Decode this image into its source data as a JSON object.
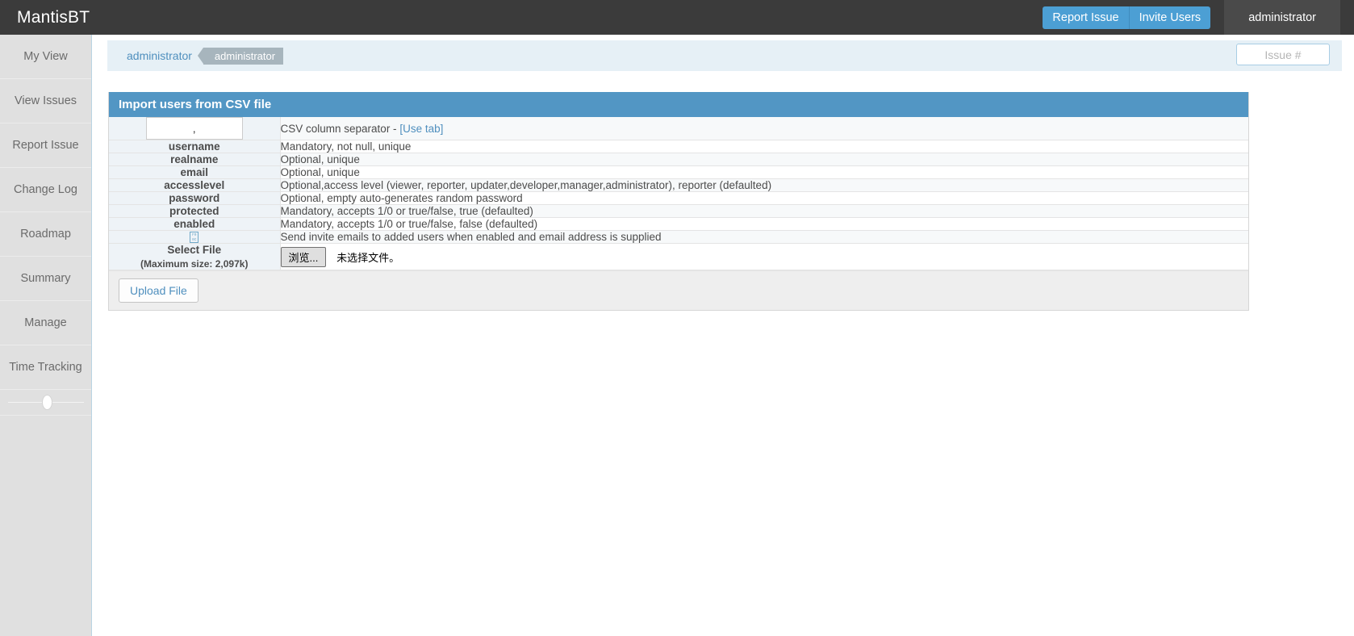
{
  "navbar": {
    "brand": "MantisBT",
    "report_issue_label": "Report Issue",
    "invite_users_label": "Invite Users",
    "user_label": "administrator",
    "accent_color": "#4c9fd4",
    "bg_color": "#3b3b3b"
  },
  "sidebar": {
    "items": [
      {
        "label": "My View"
      },
      {
        "label": "View Issues"
      },
      {
        "label": "Report Issue"
      },
      {
        "label": "Change Log"
      },
      {
        "label": "Roadmap"
      },
      {
        "label": "Summary"
      },
      {
        "label": "Manage"
      },
      {
        "label": "Time Tracking"
      }
    ]
  },
  "breadcrumb": {
    "link": "administrator",
    "tag": "administrator",
    "issue_search_placeholder": "Issue #",
    "issue_search_value": ""
  },
  "panel": {
    "title": "Import users from CSV file",
    "separator_value": ",",
    "separator_desc_prefix": "CSV column separator - ",
    "use_tab_label": "[Use tab]",
    "rows": [
      {
        "label": "username",
        "desc": "Mandatory, not null, unique"
      },
      {
        "label": "realname",
        "desc": "Optional, unique"
      },
      {
        "label": "email",
        "desc": "Optional, unique"
      },
      {
        "label": "accesslevel",
        "desc": "Optional,access level (viewer, reporter, updater,developer,manager,administrator), reporter (defaulted)"
      },
      {
        "label": "password",
        "desc": "Optional, empty auto-generates random password"
      },
      {
        "label": "protected",
        "desc": "Mandatory, accepts 1/0 or true/false, true (defaulted)"
      },
      {
        "label": "enabled",
        "desc": "Mandatory, accepts 1/0 or true/false, false (defaulted)"
      }
    ],
    "invite_desc": "Send invite emails to added users when enabled and email address is supplied",
    "invite_checkbox_glyph_top": "F0",
    "invite_checkbox_glyph_bottom": "0C",
    "select_file_label": "Select File",
    "select_file_sub": "(Maximum size: 2,097k)",
    "browse_label": "浏览...",
    "no_file_label": "未选择文件。",
    "upload_label": "Upload File"
  }
}
